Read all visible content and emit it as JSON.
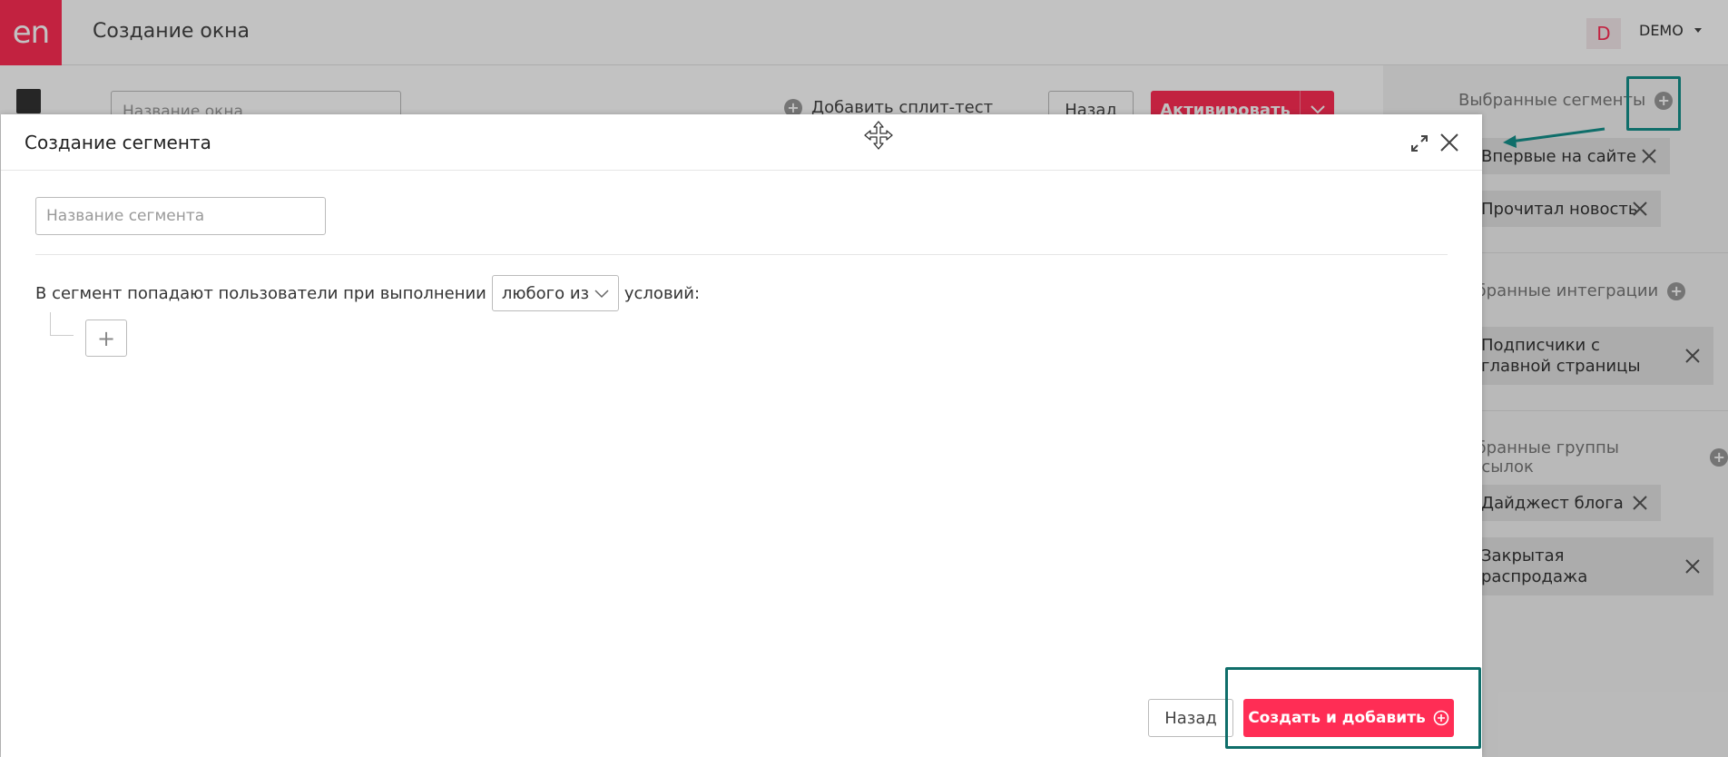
{
  "app": {
    "logo_text": "en",
    "title": "Создание окна",
    "user_initial": "D",
    "user_name": "DEMO"
  },
  "editor": {
    "window_name_placeholder": "Название окна",
    "split_test_label": "Добавить сплит-тест",
    "back_label": "Назад",
    "activate_label": "Активировать"
  },
  "right_panel": {
    "segments_title": "Выбранные сегменты",
    "segments": [
      "Впервые на сайте",
      "Прочитал новость"
    ],
    "integrations_title": "Выбранные интеграции",
    "integrations": [
      "Подписчики с главной страницы"
    ],
    "mailing_title": "Выбранные группы рассылок",
    "mailing_groups": [
      "Дайджест блога",
      "Закрытая распродажа"
    ]
  },
  "modal": {
    "title": "Создание сегмента",
    "segment_name_placeholder": "Название сегмента",
    "condition_prefix": "В сегмент попадают пользователи при выполнении",
    "condition_mode": "любого из",
    "condition_suffix": "условий:",
    "add_condition": "+",
    "back_label": "Назад",
    "create_add_label": "Создать и добавить"
  },
  "colors": {
    "accent": "#ff2d55",
    "annotation": "#0f6e6a"
  }
}
